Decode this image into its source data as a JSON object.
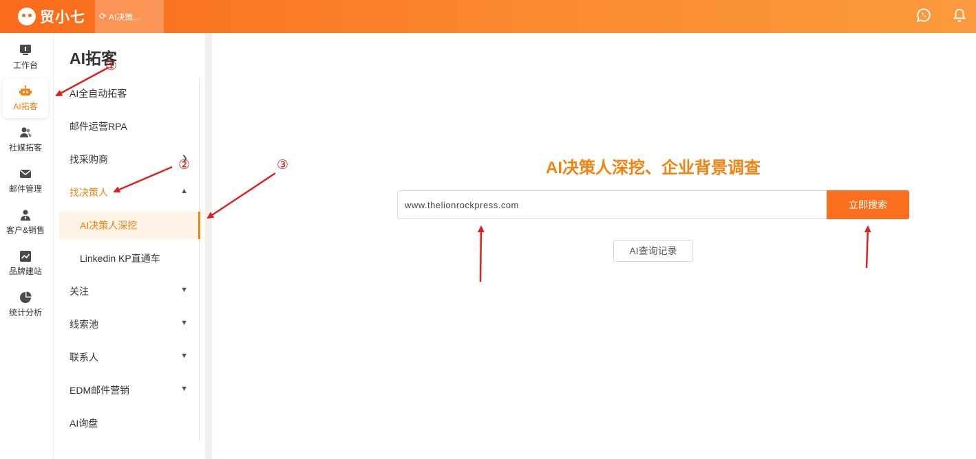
{
  "topbar": {
    "brand": "贸小七",
    "tab_label": "AI决策...",
    "icons": [
      "whatsapp-icon",
      "bell-icon"
    ]
  },
  "rail": {
    "items": [
      {
        "label": "工作台",
        "icon": "monitor-icon"
      },
      {
        "label": "AI拓客",
        "icon": "robot-icon",
        "active": true
      },
      {
        "label": "社媒拓客",
        "icon": "users-icon"
      },
      {
        "label": "邮件管理",
        "icon": "mail-icon"
      },
      {
        "label": "客户&销售",
        "icon": "person-icon"
      },
      {
        "label": "品牌建站",
        "icon": "trend-icon"
      },
      {
        "label": "统计分析",
        "icon": "pie-icon"
      }
    ]
  },
  "sidebar": {
    "title": "AI拓客",
    "items": [
      {
        "label": "AI全自动拓客"
      },
      {
        "label": "邮件运营RPA"
      },
      {
        "label": "找采购商"
      },
      {
        "label": "找决策人"
      },
      {
        "label": "AI决策人深挖"
      },
      {
        "label": "Linkedin KP直通车"
      },
      {
        "label": "关注"
      },
      {
        "label": "线索池"
      },
      {
        "label": "联系人"
      },
      {
        "label": "EDM邮件营销"
      },
      {
        "label": "AI询盘"
      }
    ]
  },
  "main": {
    "headline": "AI决策人深挖、企业背景调查",
    "search_value": "www.thelionrockpress.com",
    "search_button": "立即搜索",
    "history_button": "AI查询记录"
  },
  "annotations": {
    "marker_1": "①",
    "marker_2": "②",
    "marker_3": "③",
    "arrow_color": "#e02020"
  },
  "colors": {
    "accent": "#f5820f",
    "topbar": "#fa6b1a",
    "button": "#fb6e1d"
  }
}
